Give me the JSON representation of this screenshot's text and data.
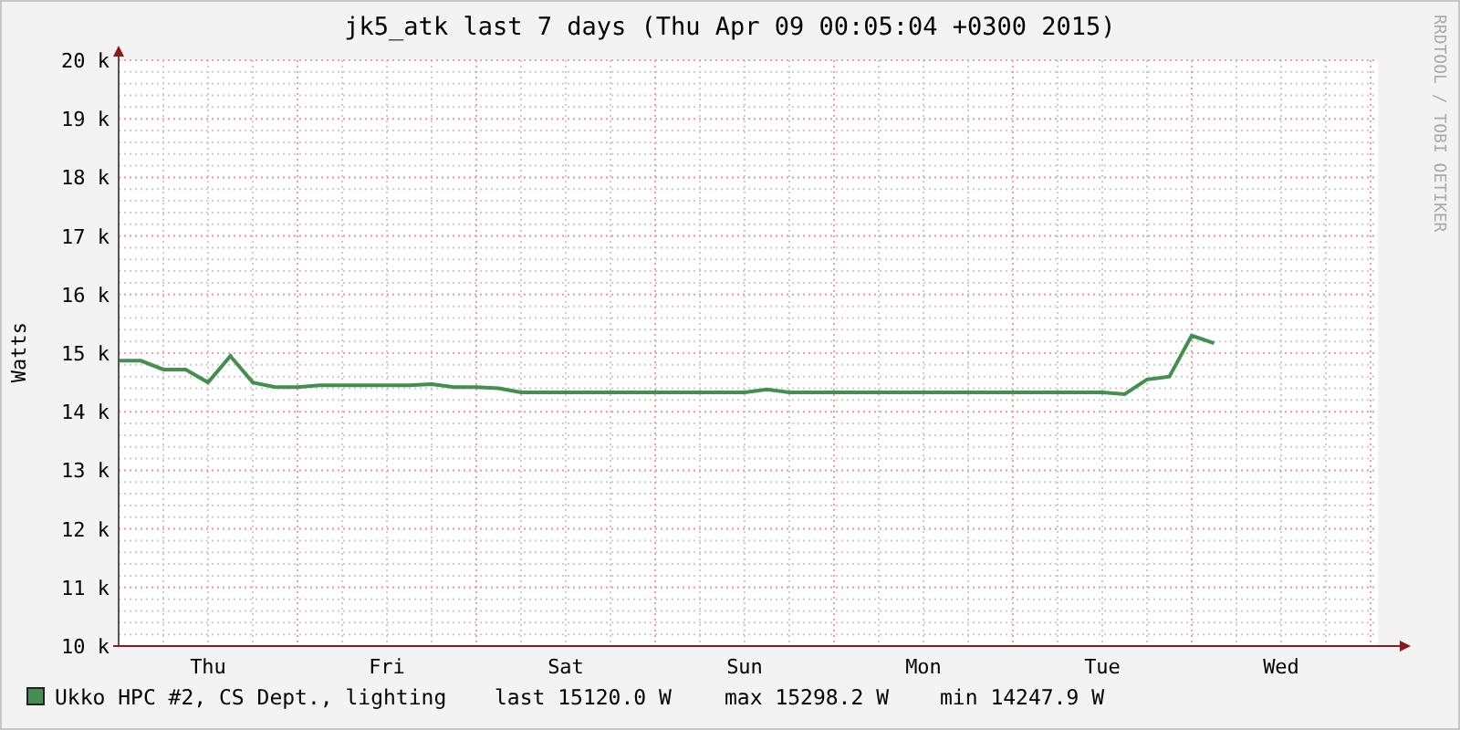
{
  "chart": {
    "chart_data": {
      "type": "line",
      "title": "jk5_atk last 7 days (Thu Apr 09 00:05:04 +0300 2015)",
      "ylabel": "Watts",
      "grid": true,
      "ylim": [
        10000,
        20000
      ],
      "categories": [
        null,
        null,
        null,
        null,
        "Thu",
        null,
        null,
        null,
        null,
        null,
        null,
        null,
        "Fri",
        null,
        null,
        null,
        null,
        null,
        null,
        null,
        "Sat",
        null,
        null,
        null,
        null,
        null,
        null,
        null,
        "Sun",
        null,
        null,
        null,
        null,
        null,
        null,
        null,
        "Mon",
        null,
        null,
        null,
        null,
        null,
        null,
        null,
        "Tue",
        null,
        null,
        null,
        null,
        null,
        null,
        null,
        "Wed",
        null,
        null,
        null,
        null
      ],
      "yticks": [
        {
          "value": 10000,
          "label": "10 k"
        },
        {
          "value": 11000,
          "label": "11 k"
        },
        {
          "value": 12000,
          "label": "12 k"
        },
        {
          "value": 13000,
          "label": "13 k"
        },
        {
          "value": 14000,
          "label": "14 k"
        },
        {
          "value": 15000,
          "label": "15 k"
        },
        {
          "value": 16000,
          "label": "16 k"
        },
        {
          "value": 17000,
          "label": "17 k"
        },
        {
          "value": 18000,
          "label": "18 k"
        },
        {
          "value": 19000,
          "label": "19 k"
        },
        {
          "value": 20000,
          "label": "20 k"
        }
      ],
      "series": [
        {
          "name": "Ukko HPC #2, CS Dept., lighting",
          "color": "#448f4f",
          "values": [
            14870,
            14870,
            14720,
            14720,
            14500,
            14950,
            14500,
            14420,
            14420,
            14450,
            14450,
            14450,
            14450,
            14450,
            14470,
            14420,
            14420,
            14400,
            14330,
            14330,
            14330,
            14330,
            14330,
            14330,
            14330,
            14330,
            14330,
            14330,
            14330,
            14380,
            14330,
            14330,
            14330,
            14330,
            14330,
            14330,
            14330,
            14330,
            14330,
            14330,
            14330,
            14330,
            14330,
            14330,
            14330,
            14300,
            14550,
            14600,
            15300,
            15170,
            null,
            null,
            null,
            null,
            null,
            null,
            null
          ]
        }
      ]
    },
    "legend": {
      "last": "last 15120.0 W",
      "max": "max 15298.2 W",
      "min": "min 14247.9 W"
    },
    "watermark_side": "RRDTOOL / TOBI OETIKER"
  }
}
